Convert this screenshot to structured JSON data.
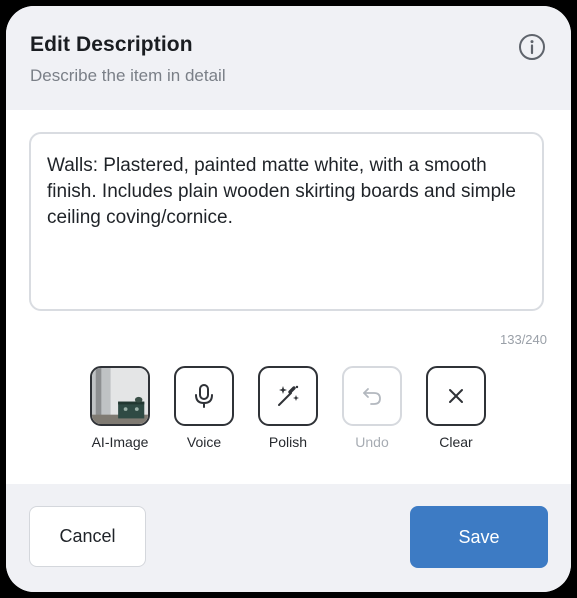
{
  "dialog": {
    "title": "Edit Description",
    "subtitle": "Describe the item in detail",
    "info_icon": "info-icon"
  },
  "editor": {
    "text": "Walls: Plastered, painted matte white, with a smooth finish. Includes plain wooden skirting boards and simple ceiling coving/cornice.",
    "counter": "133/240"
  },
  "tools": [
    {
      "label": "AI-Image",
      "icon": "image-thumbnail",
      "disabled": false
    },
    {
      "label": "Voice",
      "icon": "microphone-icon",
      "disabled": false
    },
    {
      "label": "Polish",
      "icon": "magic-wand-icon",
      "disabled": false
    },
    {
      "label": "Undo",
      "icon": "undo-icon",
      "disabled": true
    },
    {
      "label": "Clear",
      "icon": "close-icon",
      "disabled": false
    }
  ],
  "footer": {
    "cancel_label": "Cancel",
    "save_label": "Save"
  },
  "colors": {
    "accent": "#3d7bc4",
    "header_bg": "#f0f1f5",
    "disabled": "#a7acb3"
  }
}
